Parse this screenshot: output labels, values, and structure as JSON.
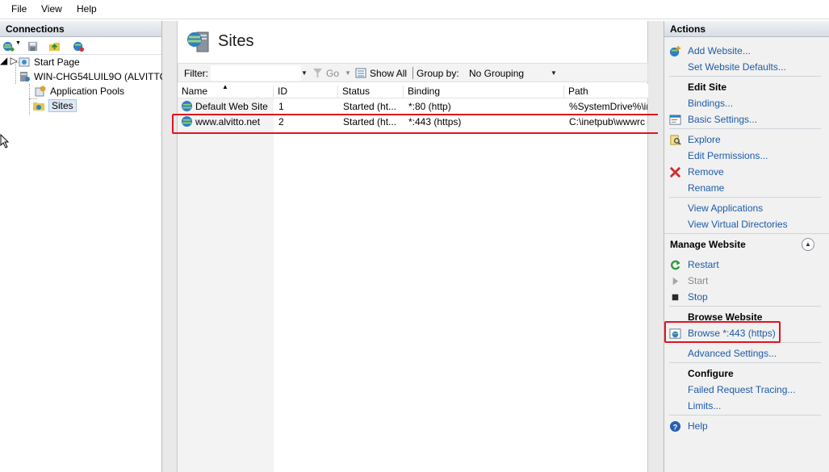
{
  "menu": {
    "file": "File",
    "view": "View",
    "help": "Help"
  },
  "connections": {
    "title": "Connections",
    "tree": {
      "start_page": "Start Page",
      "server": "WIN-CHG54LUIL9O (ALVITTO",
      "app_pools": "Application Pools",
      "sites": "Sites"
    }
  },
  "main": {
    "title": "Sites",
    "filter_label": "Filter:",
    "go_label": "Go",
    "show_all_label": "Show All",
    "group_by_label": "Group by:",
    "group_by_value": "No Grouping",
    "columns": [
      "Name",
      "ID",
      "Status",
      "Binding",
      "Path"
    ],
    "rows": [
      {
        "name": "Default Web Site",
        "id": "1",
        "status": "Started (ht...",
        "binding": "*:80 (http)",
        "path": "%SystemDrive%\\ir"
      },
      {
        "name": "www.alvitto.net",
        "id": "2",
        "status": "Started (ht...",
        "binding": "*:443 (https)",
        "path": "C:\\inetpub\\wwwrc"
      }
    ]
  },
  "actions": {
    "title": "Actions",
    "add_website": "Add Website...",
    "set_defaults": "Set Website Defaults...",
    "edit_site": "Edit Site",
    "bindings": "Bindings...",
    "basic_settings": "Basic Settings...",
    "explore": "Explore",
    "edit_permissions": "Edit Permissions...",
    "remove": "Remove",
    "rename": "Rename",
    "view_applications": "View Applications",
    "view_virtual_dirs": "View Virtual Directories",
    "manage_website": "Manage Website",
    "restart": "Restart",
    "start": "Start",
    "stop": "Stop",
    "browse_website": "Browse Website",
    "browse_443": "Browse *:443 (https)",
    "advanced_settings": "Advanced Settings...",
    "configure": "Configure",
    "failed_request_tracing": "Failed Request Tracing...",
    "limits": "Limits...",
    "help": "Help"
  },
  "colors": {
    "link": "#1e5aa8",
    "highlight": "#e0141e",
    "header_bg": "#d8dde5"
  }
}
